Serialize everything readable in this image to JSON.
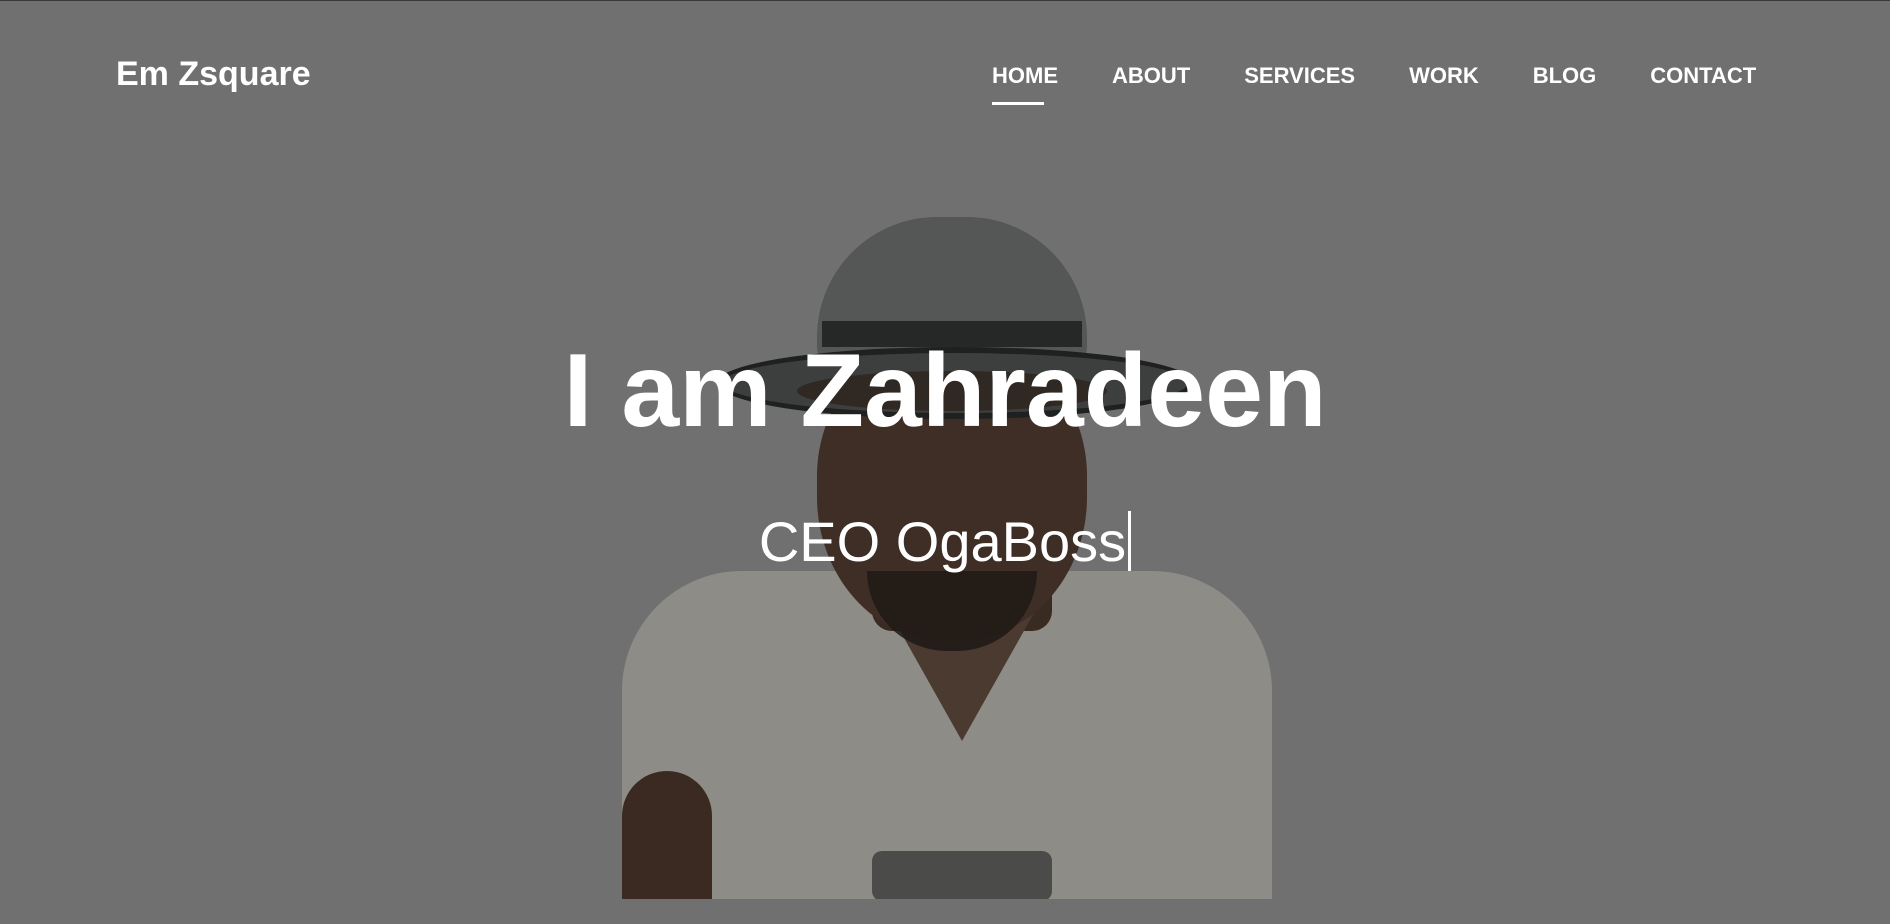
{
  "brand": {
    "name": "Em Zsquare"
  },
  "nav": {
    "items": [
      {
        "label": "HOME",
        "active": true
      },
      {
        "label": "ABOUT",
        "active": false
      },
      {
        "label": "SERVICES",
        "active": false
      },
      {
        "label": "WORK",
        "active": false
      },
      {
        "label": "BLOG",
        "active": false
      },
      {
        "label": "CONTACT",
        "active": false
      }
    ]
  },
  "hero": {
    "title": "I am Zahradeen",
    "subtitle": "CEO OgaBoss"
  },
  "colors": {
    "overlay": "#707070",
    "text": "#ffffff"
  }
}
